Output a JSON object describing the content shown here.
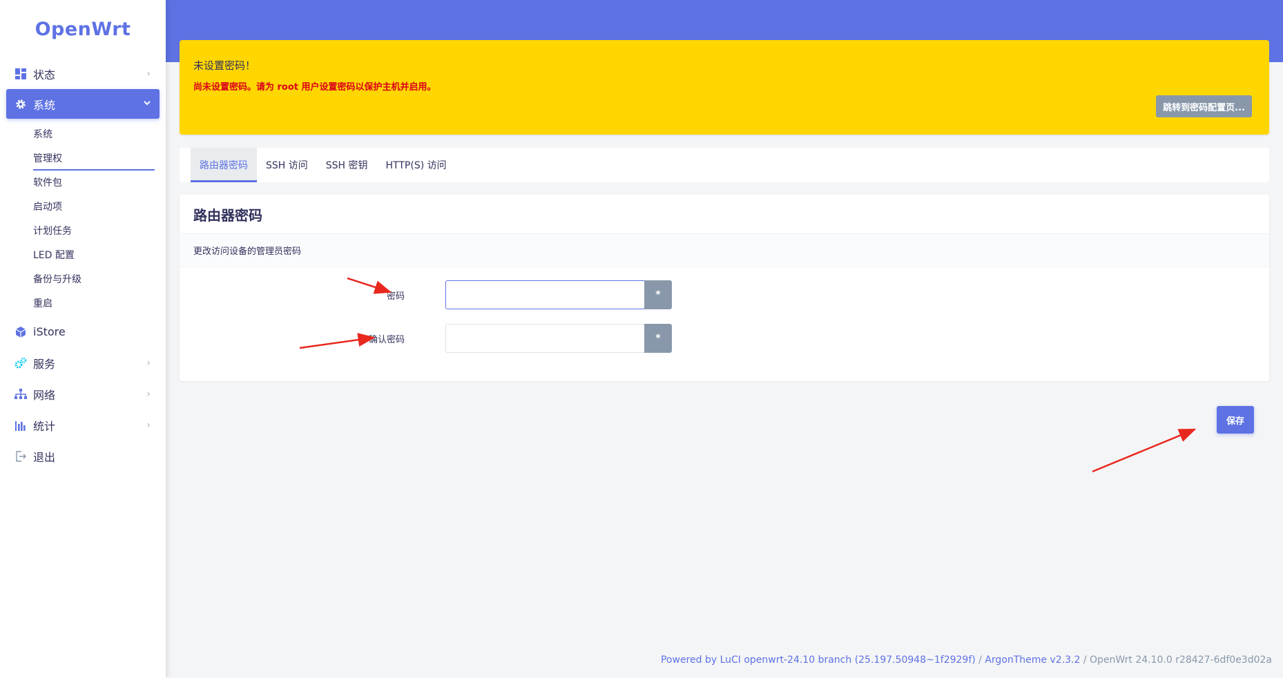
{
  "sidebar": {
    "logo": "OpenWrt",
    "items": [
      {
        "label": "状态",
        "icon": "dashboard-icon"
      },
      {
        "label": "系统",
        "icon": "gear-icon"
      },
      {
        "label": "iStore",
        "icon": "cube-icon"
      },
      {
        "label": "服务",
        "icon": "cogs-icon"
      },
      {
        "label": "网络",
        "icon": "network-icon"
      },
      {
        "label": "统计",
        "icon": "bar-chart-icon"
      },
      {
        "label": "退出",
        "icon": "logout-icon"
      }
    ],
    "system_submenu": [
      "系统",
      "管理权",
      "软件包",
      "启动项",
      "计划任务",
      "LED 配置",
      "备份与升级",
      "重启"
    ]
  },
  "alert": {
    "title": "未设置密码！",
    "message": "尚未设置密码。请为 root 用户设置密码以保护主机并启用。",
    "button": "跳转到密码配置页..."
  },
  "tabs": [
    "路由器密码",
    "SSH 访问",
    "SSH 密钥",
    "HTTP(S) 访问"
  ],
  "card": {
    "title": "路由器密码",
    "description": "更改访问设备的管理员密码",
    "fields": [
      {
        "label": "密码",
        "value": "",
        "reveal": "*"
      },
      {
        "label": "确认密码",
        "value": "",
        "reveal": "*"
      }
    ]
  },
  "actions": {
    "save": "保存"
  },
  "footer": {
    "luci": "Powered by LuCI openwrt-24.10 branch (25.197.50948~1f2929f)",
    "sep1": " / ",
    "theme": "ArgonTheme v2.3.2",
    "sep2": " / ",
    "version": "OpenWrt 24.10.0 r28427-6df0e3d02a"
  },
  "colors": {
    "primary": "#5e72e4",
    "warning": "#ffd600",
    "danger": "#d9001b",
    "secondary": "#8898aa",
    "annotation": "#e8281e"
  }
}
